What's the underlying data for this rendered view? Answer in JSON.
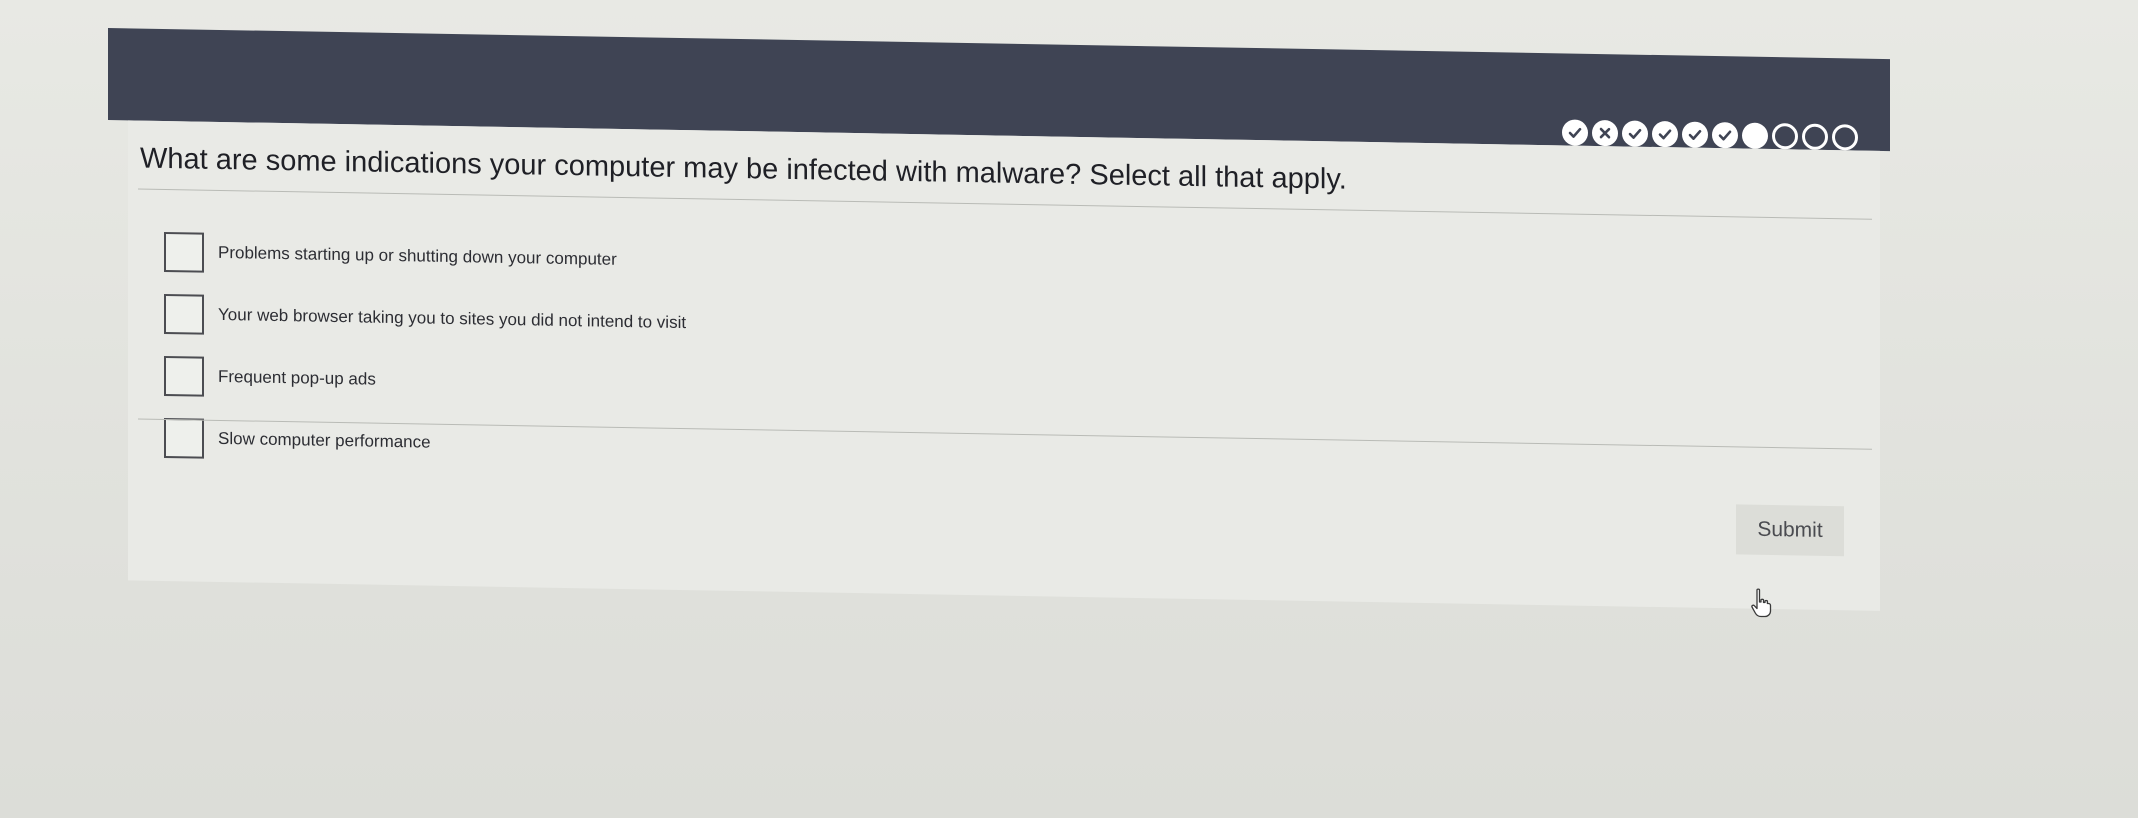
{
  "progress": [
    {
      "state": "correct",
      "icon": "check-icon"
    },
    {
      "state": "incorrect",
      "icon": "x-icon"
    },
    {
      "state": "correct",
      "icon": "check-icon"
    },
    {
      "state": "correct",
      "icon": "check-icon"
    },
    {
      "state": "correct",
      "icon": "check-icon"
    },
    {
      "state": "correct",
      "icon": "check-icon"
    },
    {
      "state": "current",
      "icon": "filled-circle-icon"
    },
    {
      "state": "pending",
      "icon": "empty-circle-icon"
    },
    {
      "state": "pending",
      "icon": "empty-circle-icon"
    },
    {
      "state": "pending",
      "icon": "empty-circle-icon"
    }
  ],
  "question": {
    "text": "What are some indications your computer may be infected with malware? Select all that apply."
  },
  "options": [
    {
      "label": "Problems starting up or shutting down your computer",
      "checked": false
    },
    {
      "label": "Your web browser taking you to sites you did not intend to visit",
      "checked": false
    },
    {
      "label": "Frequent pop-up ads",
      "checked": false
    },
    {
      "label": "Slow computer performance",
      "checked": false
    }
  ],
  "submit": {
    "label": "Submit"
  },
  "colors": {
    "header": "#3f4454",
    "panel": "#e9eae6",
    "background": "#e3e4df",
    "progress_fill": "#ffffff"
  }
}
